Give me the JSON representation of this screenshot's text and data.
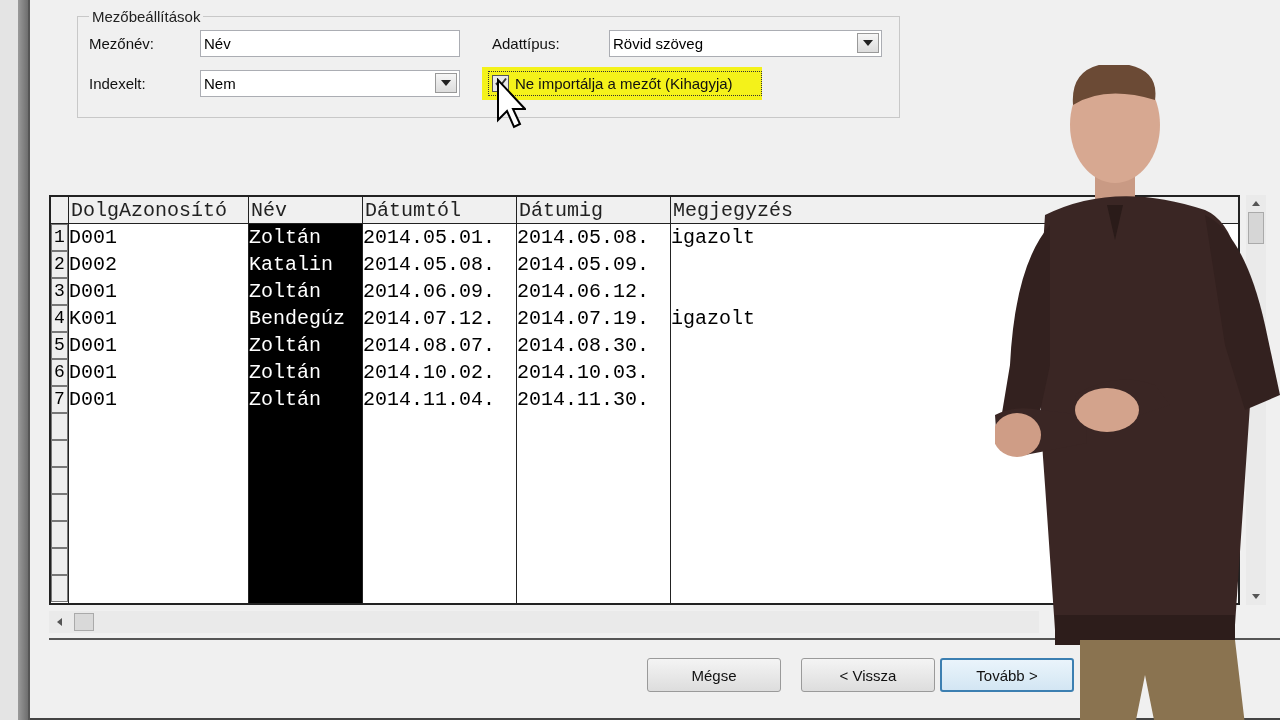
{
  "group_box": {
    "title": "Mezőbeállítások",
    "field_name": {
      "label": "Mezőnév:",
      "value": "Név"
    },
    "data_type": {
      "label": "Adattípus:",
      "value": "Rövid szöveg"
    },
    "indexed": {
      "label": "Indexelt:",
      "value": "Nem"
    },
    "skip_field": {
      "label": "Ne importálja a mezőt (Kihagyja)",
      "checked": true,
      "highlighted": true
    }
  },
  "grid": {
    "columns": [
      {
        "name": "DolgAzonosító",
        "selected": false
      },
      {
        "name": "Név",
        "selected": true
      },
      {
        "name": "Dátumtól",
        "selected": false
      },
      {
        "name": "Dátumig",
        "selected": false
      },
      {
        "name": "Megjegyzés",
        "selected": false
      }
    ],
    "rows": [
      {
        "number": "1",
        "cells": [
          "D001",
          "Zoltán",
          "2014.05.01.",
          "2014.05.08.",
          "igazolt"
        ]
      },
      {
        "number": "2",
        "cells": [
          "D002",
          "Katalin",
          "2014.05.08.",
          "2014.05.09.",
          ""
        ]
      },
      {
        "number": "3",
        "cells": [
          "D001",
          "Zoltán",
          "2014.06.09.",
          "2014.06.12.",
          ""
        ]
      },
      {
        "number": "4",
        "cells": [
          "K001",
          "Bendegúz",
          "2014.07.12.",
          "2014.07.19.",
          "igazolt"
        ]
      },
      {
        "number": "5",
        "cells": [
          "D001",
          "Zoltán",
          "2014.08.07.",
          "2014.08.30.",
          ""
        ]
      },
      {
        "number": "6",
        "cells": [
          "D001",
          "Zoltán",
          "2014.10.02.",
          "2014.10.03.",
          ""
        ]
      },
      {
        "number": "7",
        "cells": [
          "D001",
          "Zoltán",
          "2014.11.04.",
          "2014.11.30.",
          ""
        ]
      }
    ]
  },
  "buttons": [
    {
      "label": "Mégse",
      "focused": false
    },
    {
      "label": "< Vissza",
      "focused": false
    },
    {
      "label": "Tovább >",
      "focused": true
    }
  ]
}
